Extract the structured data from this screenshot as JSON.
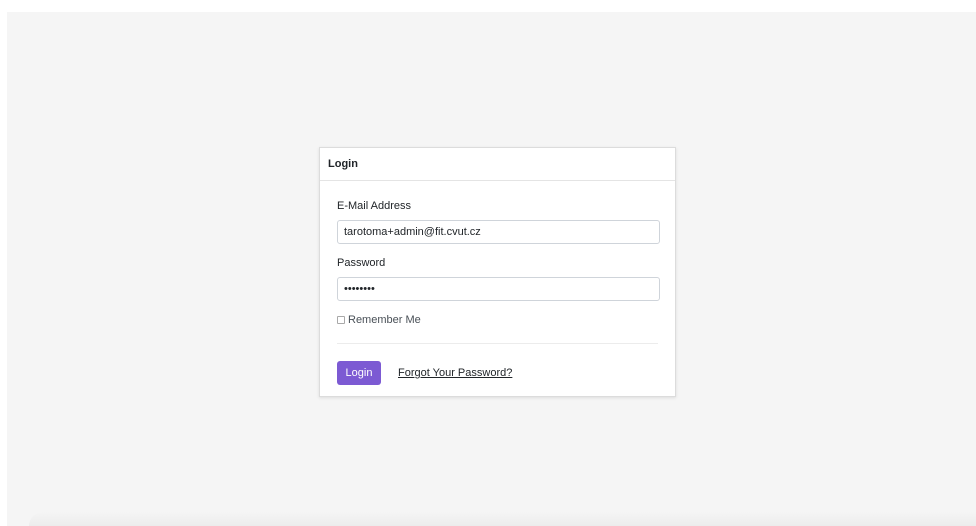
{
  "login_card": {
    "header": "Login",
    "email_label": "E-Mail Address",
    "email_value": "tarotoma+admin@fit.cvut.cz",
    "password_label": "Password",
    "password_value": "passw0rd",
    "remember_label": "Remember Me",
    "remember_checked": false,
    "login_button": "Login",
    "forgot_link": "Forgot Your Password?"
  },
  "colors": {
    "background": "#f5f5f5",
    "card": "#ffffff",
    "accent": "#7c5ad3"
  }
}
